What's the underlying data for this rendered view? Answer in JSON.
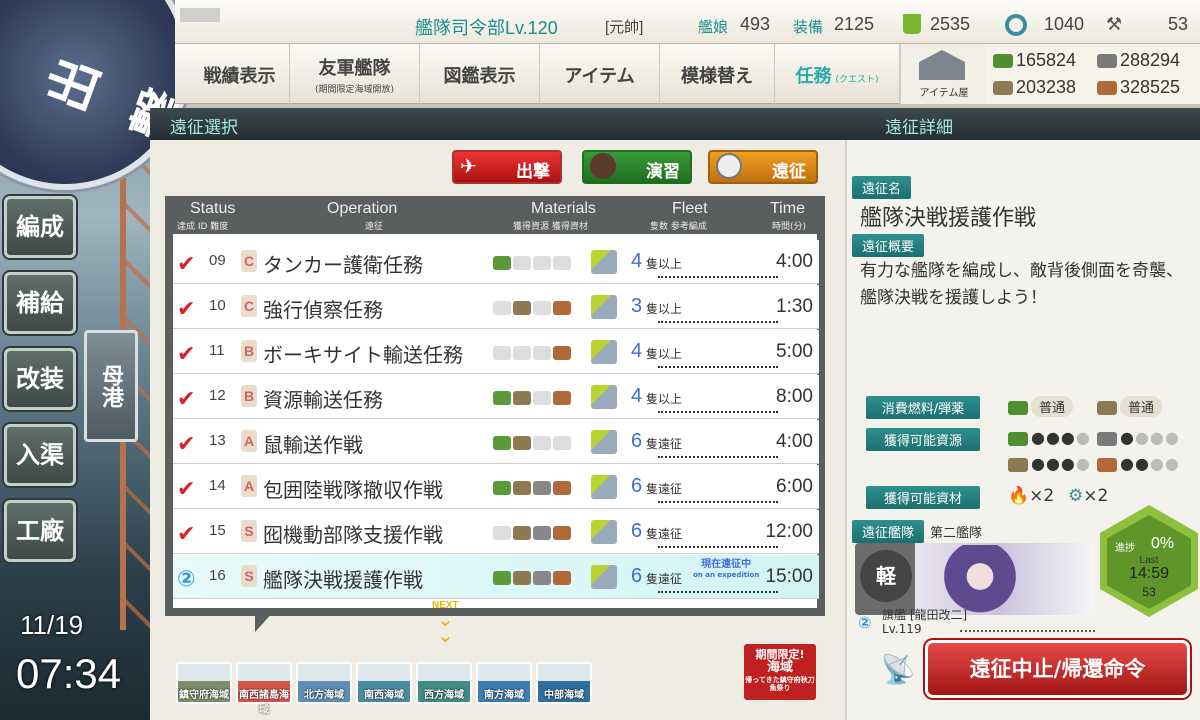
{
  "clock": {
    "date": "11/19",
    "time": "07:34"
  },
  "sortie_emblem": "出撃",
  "side_nav": [
    {
      "label": "編成"
    },
    {
      "label": "補給"
    },
    {
      "label": "改装"
    },
    {
      "label": "入渠"
    },
    {
      "label": "工廠"
    }
  ],
  "port_button": "母港",
  "header": {
    "hq_level": "艦隊司令部Lv.120",
    "rank": "[元帥]",
    "ships_label": "艦娘",
    "ships": "493",
    "equip_label": "装備",
    "equip": "2125",
    "buckets": "2535",
    "dev_materials": "1040",
    "screws": "53"
  },
  "menu": {
    "tabs": [
      {
        "label": "戦績表示"
      },
      {
        "label": "友軍艦隊",
        "sub": "(期間限定海域開放)"
      },
      {
        "label": "図鑑表示"
      },
      {
        "label": "アイテム"
      },
      {
        "label": "模様替え"
      },
      {
        "label": "任務",
        "sub": "(クエスト)"
      }
    ],
    "item_shop": "アイテム屋"
  },
  "resources": {
    "fuel": "165824",
    "steel": "288294",
    "ammo": "203238",
    "bauxite": "328525"
  },
  "sections": {
    "left": "遠征選択",
    "right": "遠征詳細"
  },
  "mode_buttons": {
    "sortie": "出撃",
    "exercise": "演習",
    "expedition": "遠征"
  },
  "table": {
    "headers": {
      "status": "Status",
      "status_sub": "達成 ID 難度",
      "operation": "Operation",
      "operation_sub": "遠征",
      "materials": "Materials",
      "materials_sub": "獲得資源 獲得資材",
      "fleet": "Fleet",
      "fleet_sub": "隻数 参考編成",
      "time": "Time",
      "time_sub": "時間(分)"
    },
    "rows": [
      {
        "id": "09",
        "diff": "C",
        "name": "タンカー護衛任務",
        "fleet_n": "4",
        "fleet_lbl": "隻以上",
        "time": "4:00",
        "mats": "f"
      },
      {
        "id": "10",
        "diff": "C",
        "name": "強行偵察任務",
        "fleet_n": "3",
        "fleet_lbl": "隻以上",
        "time": "1:30",
        "mats": "ab"
      },
      {
        "id": "11",
        "diff": "B",
        "name": "ボーキサイト輸送任務",
        "fleet_n": "4",
        "fleet_lbl": "隻以上",
        "time": "5:00",
        "mats": "b"
      },
      {
        "id": "12",
        "diff": "B",
        "name": "資源輸送任務",
        "fleet_n": "4",
        "fleet_lbl": "隻以上",
        "time": "8:00",
        "mats": "fab"
      },
      {
        "id": "13",
        "diff": "A",
        "name": "鼠輸送作戦",
        "fleet_n": "6",
        "fleet_lbl": "隻遠征",
        "time": "4:00",
        "mats": "fa"
      },
      {
        "id": "14",
        "diff": "A",
        "name": "包囲陸戦隊撤収作戦",
        "fleet_n": "6",
        "fleet_lbl": "隻遠征",
        "time": "6:00",
        "mats": "fsab"
      },
      {
        "id": "15",
        "diff": "S",
        "name": "囮機動部隊支援作戦",
        "fleet_n": "6",
        "fleet_lbl": "隻遠征",
        "time": "12:00",
        "mats": "sab"
      },
      {
        "id": "16",
        "diff": "S",
        "name": "艦隊決戦援護作戦",
        "fleet_n": "6",
        "fleet_lbl": "隻遠征",
        "time": "15:00",
        "mats": "fsab",
        "on_expedition": "現在遠征中",
        "on_expedition_en": "on an expedition"
      }
    ],
    "next": "NEXT"
  },
  "sea_areas": [
    {
      "label": "鎮守府海域",
      "color": "#7a8f6a"
    },
    {
      "label": "南西諸島海域",
      "color": "#d8544a"
    },
    {
      "label": "北方海域",
      "color": "#5d8fb5"
    },
    {
      "label": "南西海域",
      "color": "#4a8aa0"
    },
    {
      "label": "西方海域",
      "color": "#3f8c86"
    },
    {
      "label": "南方海域",
      "color": "#3b7fb0"
    },
    {
      "label": "中部海域",
      "color": "#2f6f9f"
    }
  ],
  "event_area": {
    "line1": "期間限定!",
    "line2": "海域",
    "line3": "帰ってきた鎮守府秋刀魚祭り"
  },
  "detail": {
    "name_label": "遠征名",
    "name": "艦隊決戦援護作戦",
    "summary_label": "遠征概要",
    "summary": "有力な艦隊を編成し、敵背後側面を奇襲、艦隊決戦を援護しよう！",
    "consume_label": "消費燃料/弾薬",
    "consume_fuel": "普通",
    "consume_ammo": "普通",
    "gain_res_label": "獲得可能資源",
    "gain_mat_label": "獲得可能資材",
    "mat1": "×2",
    "mat2": "×2",
    "fleet_label": "遠征艦隊",
    "fleet_name": "第二艦隊",
    "ship_type": "軽",
    "flagship": "旗艦 [龍田改二]",
    "flagship_lv": "Lv.119",
    "progress_label": "進捗",
    "progress": "0%",
    "last_label": "Last",
    "remaining": "14:59",
    "remaining_sub": "53",
    "recall_button": "遠征中止/帰還命令"
  }
}
